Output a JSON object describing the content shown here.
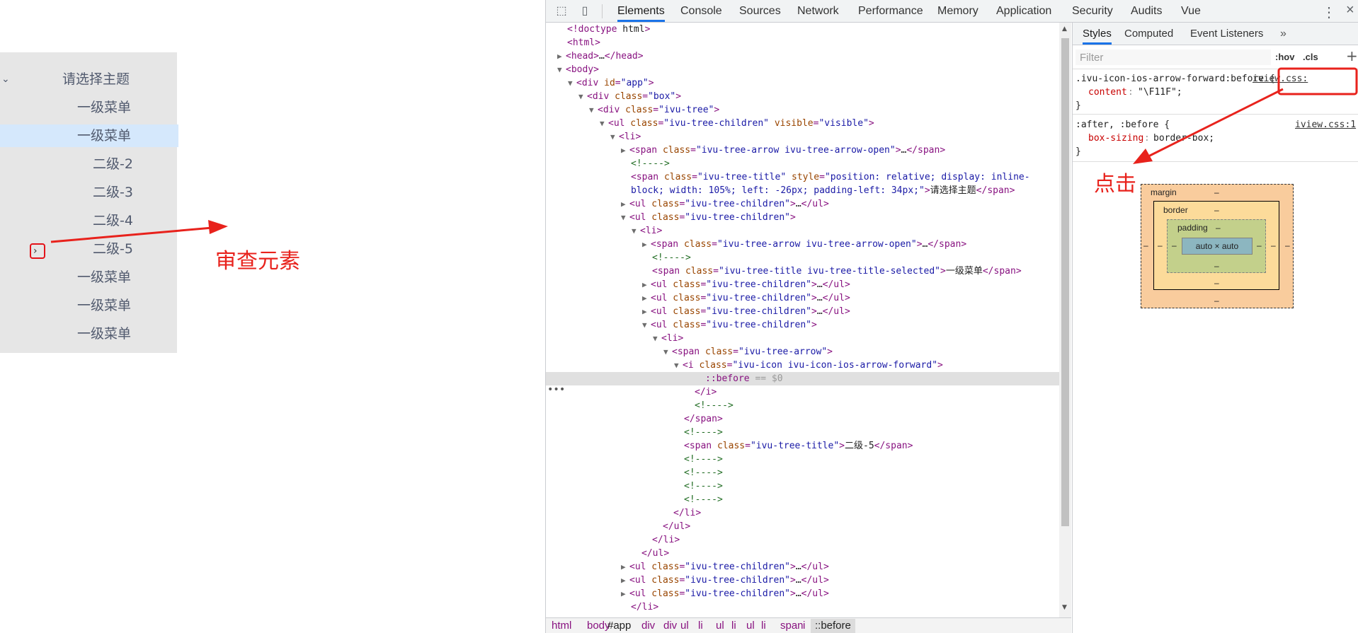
{
  "tree": {
    "root_label": "请选择主题",
    "items": [
      {
        "label": "一级菜单"
      },
      {
        "label": "一级菜单"
      },
      {
        "label": "二级-2"
      },
      {
        "label": "二级-3"
      },
      {
        "label": "二级-4"
      },
      {
        "label": "二级-5"
      },
      {
        "label": "一级菜单"
      },
      {
        "label": "一级菜单"
      },
      {
        "label": "一级菜单"
      }
    ]
  },
  "annotations": {
    "inspect": "审查元素",
    "click": "点击"
  },
  "devtools": {
    "tabs": [
      "Elements",
      "Console",
      "Sources",
      "Network",
      "Performance",
      "Memory",
      "Application",
      "Security",
      "Audits",
      "Vue"
    ],
    "active_tab": "Elements",
    "dom_lines": [
      "<!doctype html>",
      "<html>",
      "<head>…</head>",
      "<body>",
      "<div id=\"app\">",
      "<div class=\"box\">",
      "<div class=\"ivu-tree\">",
      "<ul class=\"ivu-tree-children\" visible=\"visible\">",
      "<li>",
      "<span class=\"ivu-tree-arrow ivu-tree-arrow-open\">…</span>",
      "<!---->",
      "<span class=\"ivu-tree-title\" style=\"position: relative; display: inline-block; width: 105%; left: -26px; padding-left: 34px;\">请选择主题</span>",
      "<ul class=\"ivu-tree-children\">…</ul>",
      "<ul class=\"ivu-tree-children\">",
      "<li>",
      "<span class=\"ivu-tree-arrow ivu-tree-arrow-open\">…</span>",
      "<!---->",
      "<span class=\"ivu-tree-title ivu-tree-title-selected\">一级菜单</span>",
      "<ul class=\"ivu-tree-children\">…</ul>",
      "<ul class=\"ivu-tree-children\">…</ul>",
      "<ul class=\"ivu-tree-children\">…</ul>",
      "<ul class=\"ivu-tree-children\">",
      "<li>",
      "<span class=\"ivu-tree-arrow\">",
      "<i class=\"ivu-icon ivu-icon-ios-arrow-forward\">",
      "::before == $0",
      "</i>",
      "<!---->",
      "</span>",
      "<!---->",
      "<span class=\"ivu-tree-title\">二级-5</span>",
      "<!---->",
      "<!---->",
      "<!---->",
      "<!---->",
      "</li>",
      "</ul>",
      "</li>",
      "</ul>",
      "<ul class=\"ivu-tree-children\">…</ul>",
      "<ul class=\"ivu-tree-children\">…</ul>",
      "<ul class=\"ivu-tree-children\">…</ul>",
      "</li>"
    ],
    "breadcrumbs": [
      "html",
      "body",
      "#app",
      "div",
      "div",
      "ul",
      "li",
      "ul",
      "li",
      "ul",
      "li",
      "span",
      "i",
      "::before"
    ],
    "styles": {
      "tabs": [
        "Styles",
        "Computed",
        "Event Listeners"
      ],
      "filter_placeholder": "Filter",
      "hov": ":hov",
      "cls": ".cls",
      "rule1": {
        "selector": ".ivu-icon-ios-arrow-forward:before {",
        "source": "iview.css:",
        "prop": "content",
        "value": "\"\\F11F\";",
        "close": "}"
      },
      "rule2": {
        "selector": ":after, :before {",
        "source": "iview.css:1",
        "prop": "box-sizing",
        "value": "border-box;",
        "close": "}"
      },
      "box_model": {
        "margin": "margin",
        "border": "border",
        "padding": "padding",
        "content": "auto × auto",
        "dash": "–"
      }
    }
  }
}
